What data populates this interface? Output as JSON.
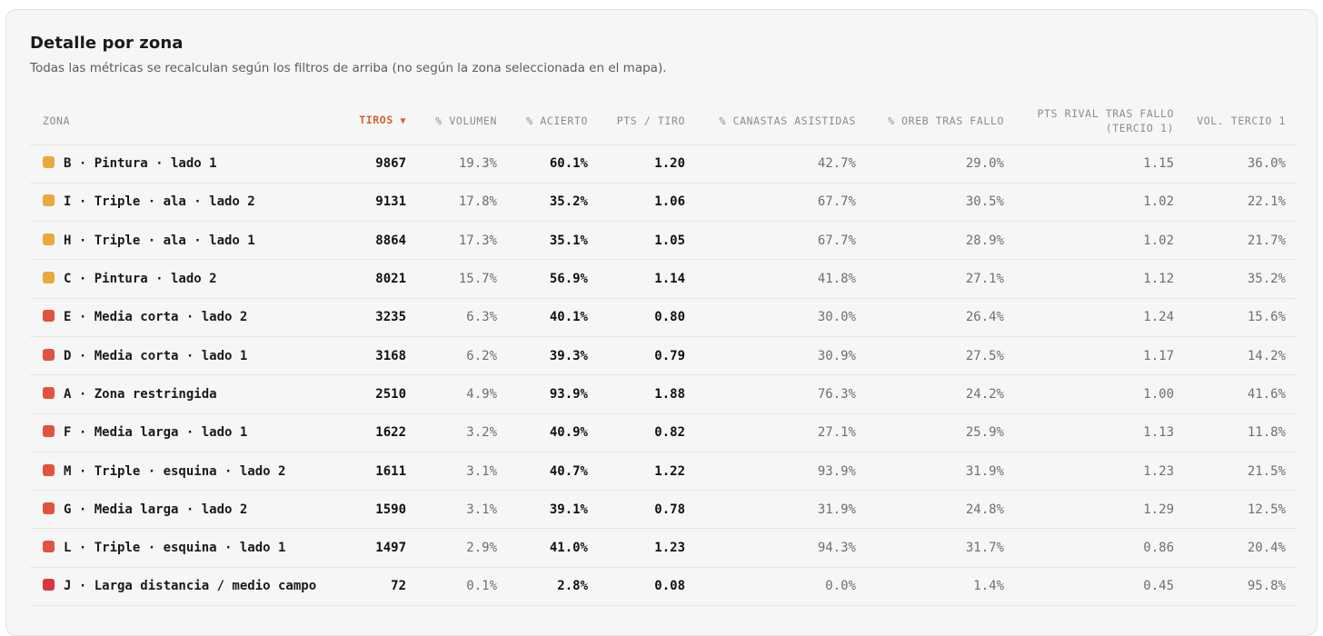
{
  "header": {
    "title": "Detalle por zona",
    "subtitle": "Todas las métricas se recalculan según los filtros de arriba (no según la zona seleccionada en el mapa)."
  },
  "table": {
    "columns": [
      {
        "label": "ZONA"
      },
      {
        "label": "TIROS",
        "sort_indicator": "▼"
      },
      {
        "label": "% VOLUMEN"
      },
      {
        "label": "% ACIERTO"
      },
      {
        "label": "PTS / TIRO"
      },
      {
        "label": "% CANASTAS ASISTIDAS"
      },
      {
        "label": "% OREB TRAS FALLO"
      },
      {
        "label": "PTS RIVAL TRAS FALLO",
        "label_line2": "(TERCIO 1)"
      },
      {
        "label": "VOL. TERCIO 1"
      }
    ],
    "sort_color": "#d9622b",
    "rows": [
      {
        "color": "#e9a93b",
        "zone": "B · Pintura · lado 1",
        "tiros": "9867",
        "volumen": "19.3%",
        "acierto": "60.1%",
        "pts_tiro": "1.20",
        "asistidas": "42.7%",
        "oreb": "29.0%",
        "pts_rival": "1.15",
        "vol_tercio": "36.0%"
      },
      {
        "color": "#eaa93b",
        "zone": "I · Triple · ala · lado 2",
        "tiros": "9131",
        "volumen": "17.8%",
        "acierto": "35.2%",
        "pts_tiro": "1.06",
        "asistidas": "67.7%",
        "oreb": "30.5%",
        "pts_rival": "1.02",
        "vol_tercio": "22.1%"
      },
      {
        "color": "#eaa93b",
        "zone": "H · Triple · ala · lado 1",
        "tiros": "8864",
        "volumen": "17.3%",
        "acierto": "35.1%",
        "pts_tiro": "1.05",
        "asistidas": "67.7%",
        "oreb": "28.9%",
        "pts_rival": "1.02",
        "vol_tercio": "21.7%"
      },
      {
        "color": "#eaa93b",
        "zone": "C · Pintura · lado 2",
        "tiros": "8021",
        "volumen": "15.7%",
        "acierto": "56.9%",
        "pts_tiro": "1.14",
        "asistidas": "41.8%",
        "oreb": "27.1%",
        "pts_rival": "1.12",
        "vol_tercio": "35.2%"
      },
      {
        "color": "#e0533f",
        "zone": "E · Media corta · lado 2",
        "tiros": "3235",
        "volumen": "6.3%",
        "acierto": "40.1%",
        "pts_tiro": "0.80",
        "asistidas": "30.0%",
        "oreb": "26.4%",
        "pts_rival": "1.24",
        "vol_tercio": "15.6%"
      },
      {
        "color": "#e0533f",
        "zone": "D · Media corta · lado 1",
        "tiros": "3168",
        "volumen": "6.2%",
        "acierto": "39.3%",
        "pts_tiro": "0.79",
        "asistidas": "30.9%",
        "oreb": "27.5%",
        "pts_rival": "1.17",
        "vol_tercio": "14.2%"
      },
      {
        "color": "#e0533f",
        "zone": "A · Zona restringida",
        "tiros": "2510",
        "volumen": "4.9%",
        "acierto": "93.9%",
        "pts_tiro": "1.88",
        "asistidas": "76.3%",
        "oreb": "24.2%",
        "pts_rival": "1.00",
        "vol_tercio": "41.6%"
      },
      {
        "color": "#e0533f",
        "zone": "F · Media larga · lado 1",
        "tiros": "1622",
        "volumen": "3.2%",
        "acierto": "40.9%",
        "pts_tiro": "0.82",
        "asistidas": "27.1%",
        "oreb": "25.9%",
        "pts_rival": "1.13",
        "vol_tercio": "11.8%"
      },
      {
        "color": "#e0533f",
        "zone": "M · Triple · esquina · lado 2",
        "tiros": "1611",
        "volumen": "3.1%",
        "acierto": "40.7%",
        "pts_tiro": "1.22",
        "asistidas": "93.9%",
        "oreb": "31.9%",
        "pts_rival": "1.23",
        "vol_tercio": "21.5%"
      },
      {
        "color": "#e0533f",
        "zone": "G · Media larga · lado 2",
        "tiros": "1590",
        "volumen": "3.1%",
        "acierto": "39.1%",
        "pts_tiro": "0.78",
        "asistidas": "31.9%",
        "oreb": "24.8%",
        "pts_rival": "1.29",
        "vol_tercio": "12.5%"
      },
      {
        "color": "#e0533f",
        "zone": "L · Triple · esquina · lado 1",
        "tiros": "1497",
        "volumen": "2.9%",
        "acierto": "41.0%",
        "pts_tiro": "1.23",
        "asistidas": "94.3%",
        "oreb": "31.7%",
        "pts_rival": "0.86",
        "vol_tercio": "20.4%"
      },
      {
        "color": "#d9363e",
        "zone": "J · Larga distancia / medio campo",
        "tiros": "72",
        "volumen": "0.1%",
        "acierto": "2.8%",
        "pts_tiro": "0.08",
        "asistidas": "0.0%",
        "oreb": "1.4%",
        "pts_rival": "0.45",
        "vol_tercio": "95.8%"
      }
    ]
  }
}
